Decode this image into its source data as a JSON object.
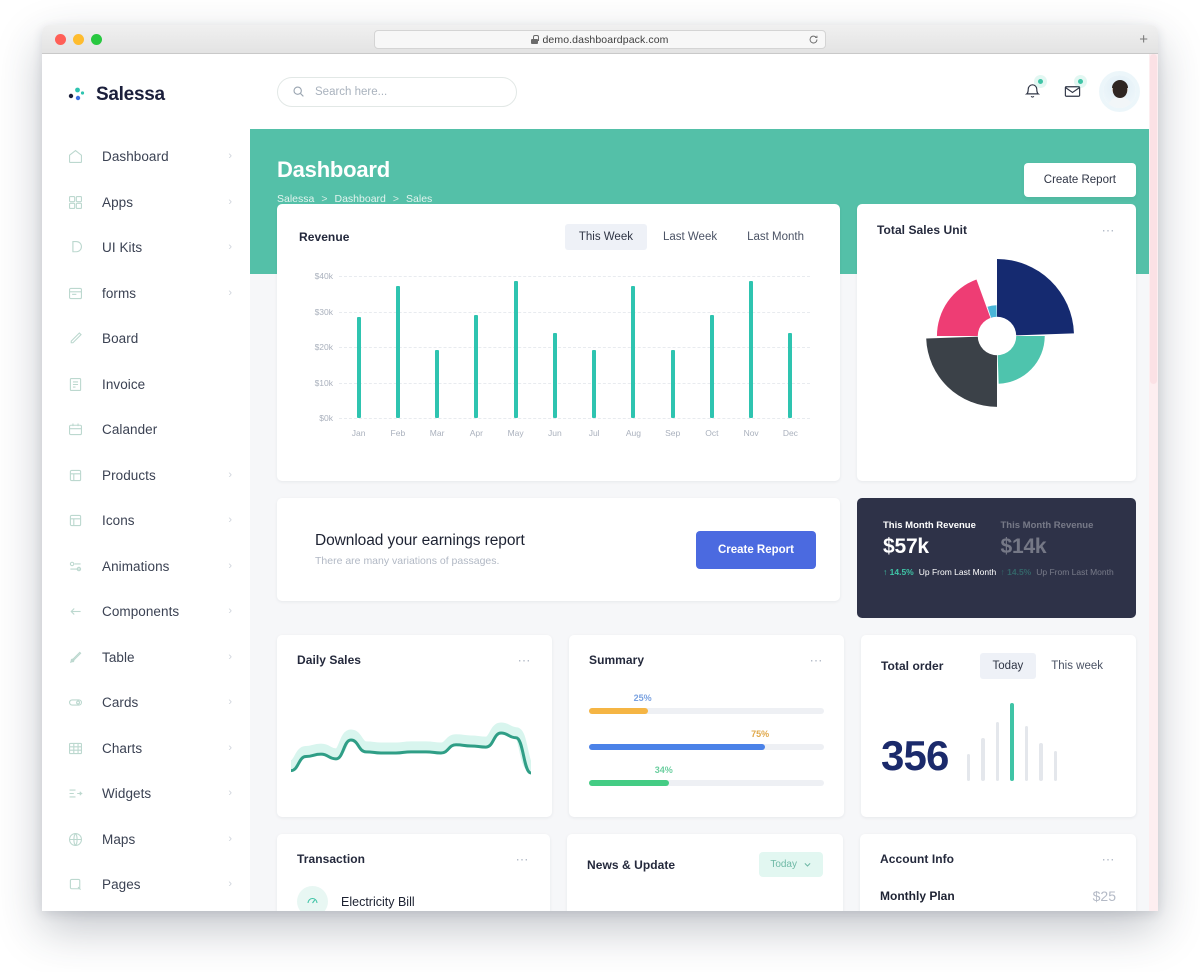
{
  "browser": {
    "url": "demo.dashboardpack.com",
    "lock_icon": "lock-icon",
    "reload_icon": "reload-icon",
    "new_tab_label": "+"
  },
  "brand": {
    "name": "Salessa",
    "logo_icon": "salessa-logo-icon"
  },
  "sidebar": {
    "items": [
      {
        "label": "Dashboard",
        "icon": "home-icon",
        "chevron": "›",
        "has_chevron": true
      },
      {
        "label": "Apps",
        "icon": "grid-apps-icon",
        "chevron": "›",
        "has_chevron": true
      },
      {
        "label": "UI Kits",
        "icon": "ui-kit-icon",
        "chevron": "›",
        "has_chevron": true
      },
      {
        "label": "forms",
        "icon": "form-icon",
        "chevron": "›",
        "has_chevron": true
      },
      {
        "label": "Board",
        "icon": "board-icon",
        "chevron": "",
        "has_chevron": false
      },
      {
        "label": "Invoice",
        "icon": "invoice-icon",
        "chevron": "",
        "has_chevron": false
      },
      {
        "label": "Calander",
        "icon": "calendar-icon",
        "chevron": "",
        "has_chevron": false
      },
      {
        "label": "Products",
        "icon": "products-icon",
        "chevron": "›",
        "has_chevron": true
      },
      {
        "label": "Icons",
        "icon": "icons-icon",
        "chevron": "›",
        "has_chevron": true
      },
      {
        "label": "Animations",
        "icon": "animations-icon",
        "chevron": "›",
        "has_chevron": true
      },
      {
        "label": "Components",
        "icon": "components-icon",
        "chevron": "›",
        "has_chevron": true
      },
      {
        "label": "Table",
        "icon": "table-icon",
        "chevron": "›",
        "has_chevron": true
      },
      {
        "label": "Cards",
        "icon": "cards-icon",
        "chevron": "›",
        "has_chevron": true
      },
      {
        "label": "Charts",
        "icon": "charts-icon",
        "chevron": "›",
        "has_chevron": true
      },
      {
        "label": "Widgets",
        "icon": "widgets-icon",
        "chevron": "›",
        "has_chevron": true
      },
      {
        "label": "Maps",
        "icon": "maps-icon",
        "chevron": "›",
        "has_chevron": true
      },
      {
        "label": "Pages",
        "icon": "pages-icon",
        "chevron": "›",
        "has_chevron": true
      }
    ]
  },
  "topbar": {
    "search_placeholder": "Search here...",
    "search_value": "",
    "search_icon": "search-icon",
    "bell_icon": "bell-icon",
    "mail_icon": "envelope-icon",
    "avatar": "user-avatar"
  },
  "hero": {
    "title": "Dashboard",
    "breadcrumb": [
      "Salessa",
      "Dashboard",
      "Sales"
    ],
    "separator": ">",
    "button_label": "Create Report",
    "accent": "#54c0a8"
  },
  "revenue": {
    "title": "Revenue",
    "tabs": [
      {
        "label": "This Week",
        "active": true
      },
      {
        "label": "Last Week",
        "active": false
      },
      {
        "label": "Last Month",
        "active": false
      }
    ]
  },
  "sales_unit": {
    "title": "Total Sales Unit",
    "menu_icon": "more-options-icon"
  },
  "earnings": {
    "title": "Download your earnings report",
    "subtitle": "There are many variations of passages.",
    "button_label": "Create Report",
    "button_color": "#4b6ae0"
  },
  "month_revenue": {
    "primary": {
      "label": "This Month Revenue",
      "value": "$57k",
      "delta": "14.5%",
      "delta_arrow": "↑",
      "note": "Up From Last Month"
    },
    "secondary": {
      "label": "This Month Revenue",
      "value": "$14k",
      "delta": "14.5%",
      "delta_arrow": "↑",
      "note": "Up From Last Month"
    },
    "bg": "#2e3248",
    "delta_color": "#3fc4a6"
  },
  "daily_sales": {
    "title": "Daily Sales",
    "menu_icon": "more-options-icon"
  },
  "summary": {
    "title": "Summary",
    "menu_icon": "more-options-icon",
    "rows": [
      {
        "pct": "25%",
        "value": 25,
        "bar_color": "#f5b544",
        "label_color": "#7aa2e0"
      },
      {
        "pct": "75%",
        "value": 75,
        "bar_color": "#4b82e8",
        "label_color": "#e0a84a"
      },
      {
        "pct": "34%",
        "value": 34,
        "bar_color": "#44cc84",
        "label_color": "#6ccfa0"
      }
    ]
  },
  "total_order": {
    "title": "Total order",
    "value": "356",
    "tabs": [
      {
        "label": "Today",
        "active": true
      },
      {
        "label": "This week",
        "active": false
      }
    ]
  },
  "transaction": {
    "title": "Transaction",
    "menu_icon": "more-options-icon",
    "first_item": "Electricity Bill",
    "item_icon": "bill-icon"
  },
  "news": {
    "title": "News & Update",
    "filter_label": "Today",
    "filter_icon": "chevron-down-icon"
  },
  "account_info": {
    "title": "Account Info",
    "menu_icon": "more-options-icon",
    "row_label": "Monthly Plan",
    "row_value": "$25"
  },
  "chart_data": [
    {
      "type": "bar",
      "title": "Revenue",
      "categories": [
        "Jan",
        "Feb",
        "Mar",
        "Apr",
        "May",
        "Jun",
        "Jul",
        "Aug",
        "Sep",
        "Oct",
        "Nov",
        "Dec"
      ],
      "values": [
        30000,
        39000,
        20000,
        30500,
        40500,
        25000,
        20000,
        39000,
        20000,
        30500,
        40500,
        25000
      ],
      "ytick_labels": [
        "$40k",
        "$30k",
        "$20k",
        "$10k",
        "$0k"
      ],
      "ytick_values": [
        40000,
        30000,
        20000,
        10000,
        0
      ],
      "ylim": [
        0,
        42000
      ],
      "xlabel": "",
      "ylabel": "",
      "grid": true,
      "legend": "none",
      "series_color": "#2ec4b0"
    },
    {
      "type": "pie",
      "title": "Total Sales Unit",
      "variant": "polar-area-donut",
      "slices": [
        {
          "name": "segment-navy",
          "color": "#152a70",
          "start_deg": 0,
          "sweep_deg": 88,
          "radius_pct": 100
        },
        {
          "name": "segment-teal",
          "color": "#4ec4ad",
          "start_deg": 90,
          "sweep_deg": 88,
          "radius_pct": 62
        },
        {
          "name": "segment-slate",
          "color": "#3b4148",
          "start_deg": 180,
          "sweep_deg": 88,
          "radius_pct": 92
        },
        {
          "name": "segment-pink",
          "color": "#ee3d74",
          "start_deg": 270,
          "sweep_deg": 70,
          "radius_pct": 78
        },
        {
          "name": "segment-lightblue",
          "color": "#49b6d8",
          "start_deg": 342,
          "sweep_deg": 17,
          "radius_pct": 40
        }
      ],
      "hole_pct": 25
    },
    {
      "type": "line",
      "title": "Daily Sales",
      "x": [
        0,
        1,
        2,
        3,
        4,
        5,
        6,
        7,
        8,
        9,
        10,
        11,
        12,
        13,
        14,
        15,
        16
      ],
      "values": [
        30,
        42,
        44,
        40,
        56,
        46,
        45,
        45,
        46,
        46,
        45,
        52,
        51,
        50,
        62,
        58,
        28
      ],
      "series_color": "#2f9e86",
      "grid": false,
      "legend": "none"
    },
    {
      "type": "bar",
      "title": "Summary",
      "orientation": "horizontal",
      "categories": [
        "25%",
        "75%",
        "34%"
      ],
      "values": [
        25,
        75,
        34
      ],
      "colors": [
        "#f5b544",
        "#4b82e8",
        "#44cc84"
      ],
      "xlim": [
        0,
        100
      ],
      "grid": false,
      "legend": "none"
    },
    {
      "type": "bar",
      "title": "Total order",
      "categories": [
        "1",
        "2",
        "3",
        "4",
        "5",
        "6",
        "7"
      ],
      "values": [
        28,
        45,
        62,
        82,
        58,
        40,
        32
      ],
      "highlight_index": 3,
      "series_color": "#e4e7ec",
      "highlight_color": "#3fc4a6",
      "grid": false,
      "legend": "none"
    }
  ]
}
